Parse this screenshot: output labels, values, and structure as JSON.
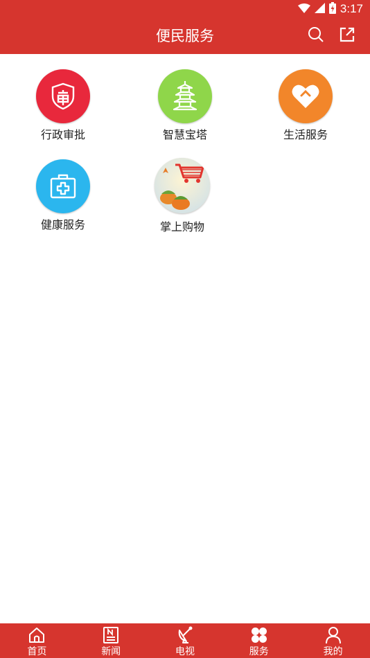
{
  "status_bar": {
    "time": "3:17",
    "icons": [
      "wifi-icon",
      "signal-icon",
      "battery-charging-icon"
    ]
  },
  "header": {
    "title": "便民服务",
    "actions": [
      "search-icon",
      "share-external-icon"
    ]
  },
  "services": [
    {
      "label": "行政审批",
      "icon": "approval-shield-icon",
      "color": "#e8283c"
    },
    {
      "label": "智慧宝塔",
      "icon": "pagoda-icon",
      "color": "#8fd64a"
    },
    {
      "label": "生活服务",
      "icon": "heart-icon",
      "color": "#f2862a"
    },
    {
      "label": "健康服务",
      "icon": "medical-kit-icon",
      "color": "#2bb6ee"
    },
    {
      "label": "掌上购物",
      "icon": "shopping-cart-icon",
      "color": "#e9a64a"
    }
  ],
  "bottom_nav": [
    {
      "label": "首页",
      "icon": "home-icon"
    },
    {
      "label": "新闻",
      "icon": "news-icon"
    },
    {
      "label": "电视",
      "icon": "tv-dish-icon"
    },
    {
      "label": "服务",
      "icon": "clover-grid-icon",
      "active": true
    },
    {
      "label": "我的",
      "icon": "user-icon"
    }
  ],
  "theme": {
    "primary": "#d6352e"
  }
}
